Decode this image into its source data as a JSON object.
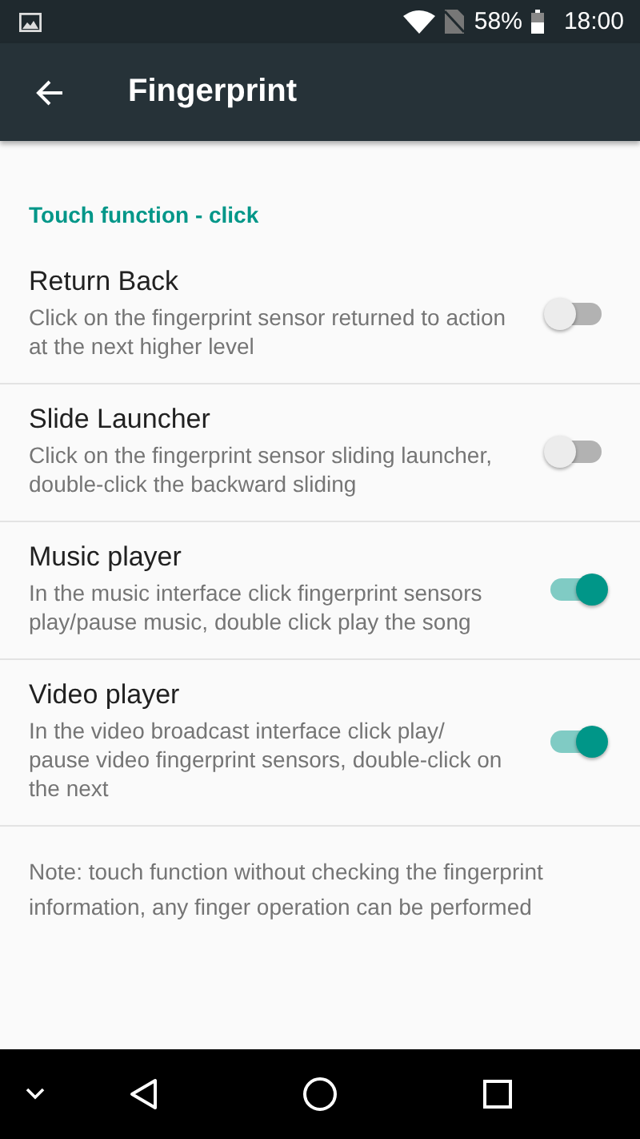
{
  "status_bar": {
    "battery": "58%",
    "time": "18:00"
  },
  "app_bar": {
    "title": "Fingerprint"
  },
  "section": {
    "title": "Touch function - click"
  },
  "settings": [
    {
      "title": "Return Back",
      "description": "Click on the fingerprint sensor returned to action at the next higher level",
      "on": false
    },
    {
      "title": "Slide Launcher",
      "description": "Click on the fingerprint sensor sliding launcher, double-click the backward sliding",
      "on": false
    },
    {
      "title": "Music player",
      "description": "In the music interface click fingerprint sensors play/pause music, double click play the song",
      "on": true
    },
    {
      "title": "Video player",
      "description": "In the video broadcast interface click play/ pause video fingerprint sensors, double-click on the next",
      "on": true
    }
  ],
  "note": "Note: touch function without checking the fingerprint information, any finger operation can be performed"
}
